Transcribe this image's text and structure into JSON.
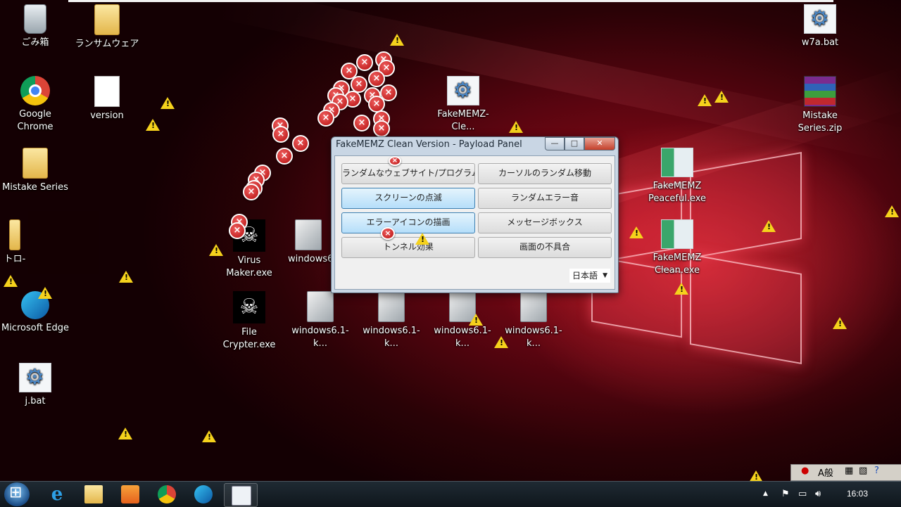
{
  "desktop_icons": {
    "recycle_bin": "ごみ箱",
    "ransomware_folder": "ランサムウェア",
    "w7a_bat": "w7a.bat",
    "google_chrome": "Google Chrome",
    "version": "version",
    "fakememz_clean_top": "FakeMEMZ-Cle...",
    "mistake_zip_line1": "Mistake",
    "mistake_zip_line2": "Series.zip",
    "mistake_series_folder": "Mistake Series",
    "fakememz_peaceful_line1": "FakeMEMZ",
    "fakememz_peaceful_line2": "Peaceful.exe",
    "fakememz_clean_line1": "FakeMEMZ",
    "fakememz_clean_line2": "Clean.exe",
    "trojan_folder": "トロ-",
    "virus_maker": "Virus Maker.exe",
    "windows6_partial": "windows6",
    "microsoft_edge": "Microsoft Edge",
    "file_crypter": "File Crypter.exe",
    "win_pkg_1": "windows6.1-k...",
    "win_pkg_2": "windows6.1-k...",
    "win_pkg_3": "windows6.1-k...",
    "win_pkg_4": "windows6.1-k...",
    "j_bat": "j.bat"
  },
  "dialog": {
    "title": "FakeMEMZ Clean Version - Payload Panel",
    "controls": {
      "minimize": "—",
      "maximize": "□",
      "close": "✕"
    },
    "buttons": {
      "random_websites": "ランダムなウェブサイト/プログラムを開く",
      "random_cursor": "カーソルのランダム移動",
      "screen_flash": "スクリーンの点滅",
      "random_error_sound": "ランダムエラー音",
      "draw_error_icons": "エラーアイコンの描画",
      "message_box": "メッセージボックス",
      "tunnel_effect": "トンネル効果",
      "screen_glitch": "画面の不具合"
    },
    "language": "日本語"
  },
  "taskbar": {
    "clock": "16:03",
    "language_bar": "A般"
  },
  "icons": {
    "start": "windows-start-icon",
    "ie": "internet-explorer-icon",
    "explorer": "file-explorer-icon",
    "media": "media-player-icon",
    "chrome": "chrome-icon",
    "edge": "edge-icon",
    "calc": "calculator-icon"
  }
}
